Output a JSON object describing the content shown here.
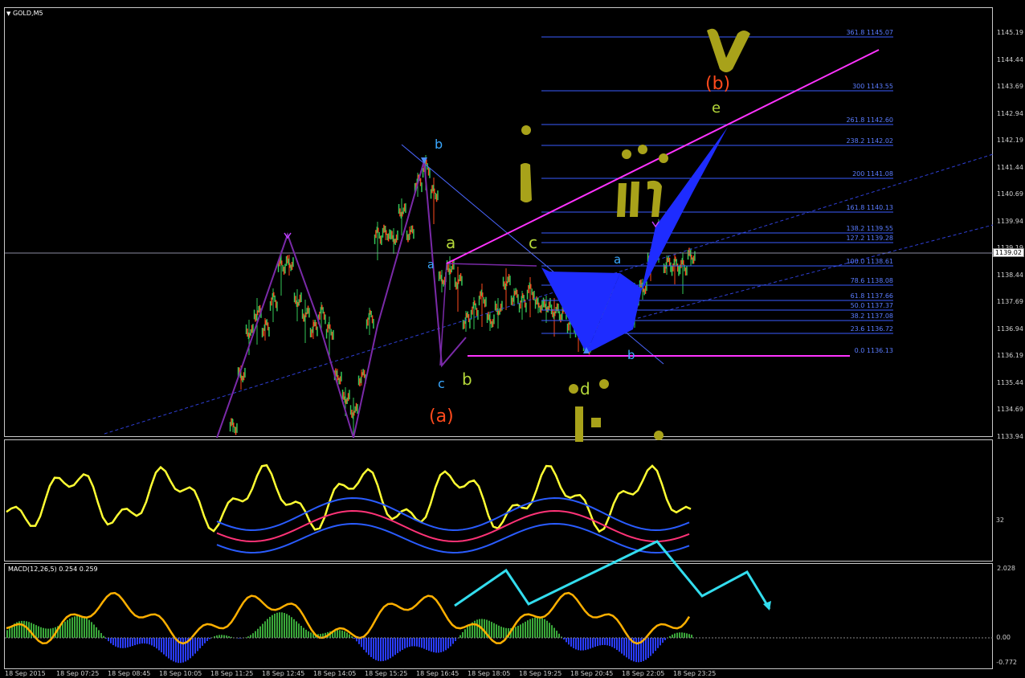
{
  "header": {
    "symbol": "GOLD,M5"
  },
  "price_axis": [
    "1145.19",
    "1144.44",
    "1143.69",
    "1142.94",
    "1142.19",
    "1141.44",
    "1140.69",
    "1139.94",
    "1139.19",
    "1138.44",
    "1137.69",
    "1136.94",
    "1136.19",
    "1135.44",
    "1134.69",
    "1133.94"
  ],
  "current_price": "1139.02",
  "fib_levels": [
    {
      "text": "361.8  1145.07"
    },
    {
      "text": "300  1143.55"
    },
    {
      "text": "261.8  1142.60"
    },
    {
      "text": "238.2  1142.02"
    },
    {
      "text": "200  1141.08"
    },
    {
      "text": "161.8  1140.13"
    },
    {
      "text": "138.2  1139.55"
    },
    {
      "text": "127.2  1139.28"
    },
    {
      "text": "100.0  1138.61"
    },
    {
      "text": "78.6  1138.08"
    },
    {
      "text": "61.8  1137.66"
    },
    {
      "text": "50.0  1137.37"
    },
    {
      "text": "38.2  1137.08"
    },
    {
      "text": "23.6  1136.72"
    },
    {
      "text": "0.0  1136.13"
    }
  ],
  "wave_labels": {
    "b_top": "b",
    "a_left": "a",
    "a_green": "a",
    "c_blue": "c",
    "b_green": "b",
    "a_paren": "(a)",
    "c_green": "c",
    "a_blue2": "a",
    "b_blue2": "b",
    "d_green": "d",
    "e_green": "e",
    "b_paren": "(b)"
  },
  "indicator": {
    "level": "32"
  },
  "macd": {
    "title": "MACD(12,26,5) 0.254 0.259",
    "ticks": [
      "2.028",
      "0.00",
      "-0.772"
    ]
  },
  "time_axis": [
    "18 Sep 2015",
    "18 Sep 07:25",
    "18 Sep 08:45",
    "18 Sep 10:05",
    "18 Sep 11:25",
    "18 Sep 12:45",
    "18 Sep 14:05",
    "18 Sep 15:25",
    "18 Sep 16:45",
    "18 Sep 18:05",
    "18 Sep 19:25",
    "18 Sep 20:45",
    "18 Sep 22:05",
    "18 Sep 23:25"
  ],
  "colors": {
    "bull": "#34c759",
    "bear": "#ff4a1c",
    "fib": "#5a7cff",
    "magenta": "#ff33ff",
    "yellow": "#ffff33",
    "cyan": "#33ddee",
    "olive": "#b5b000"
  }
}
